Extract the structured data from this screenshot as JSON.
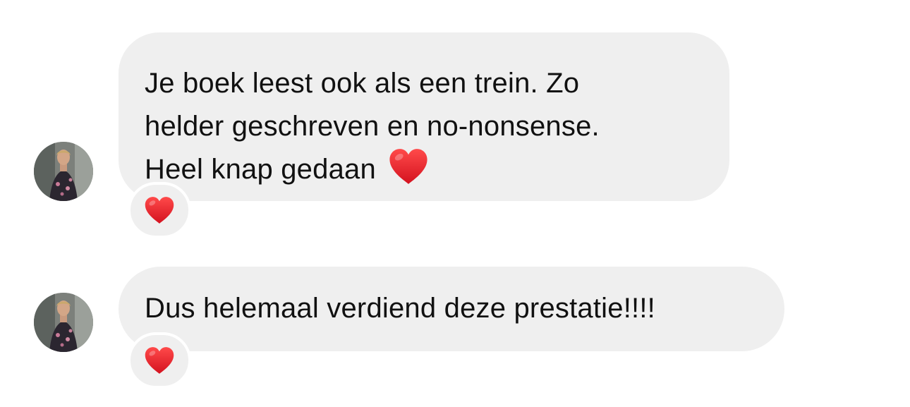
{
  "messages": [
    {
      "lines": [
        "Je boek leest ook als een trein. Zo",
        "helder geschreven en no-nonsense.",
        "Heel knap gedaan"
      ],
      "trailing_emoji": "red-heart",
      "reaction": "red-heart"
    },
    {
      "lines": [
        "Dus helemaal verdiend deze prestatie!!!!"
      ],
      "reaction": "red-heart"
    }
  ],
  "colors": {
    "bubble_bg": "#efefef",
    "text": "#111111",
    "heart": "#e3212b"
  }
}
